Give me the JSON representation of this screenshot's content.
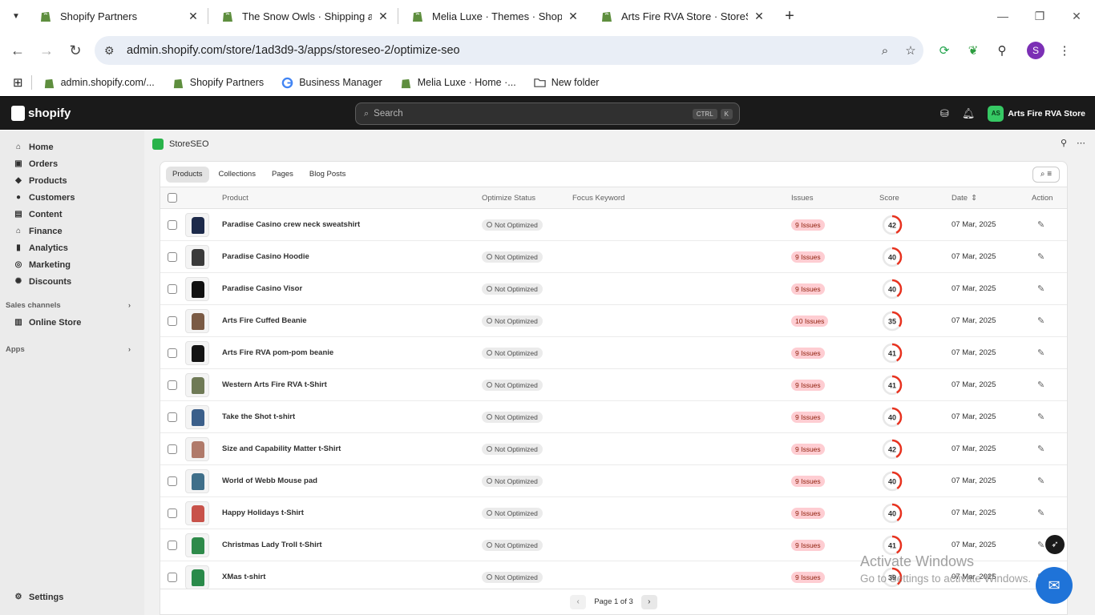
{
  "browser": {
    "tabs": [
      {
        "title": "Shopify Partners",
        "active": false
      },
      {
        "title": "The Snow Owls · Shipping and d",
        "active": false
      },
      {
        "title": "Melia Luxe · Themes · Shopify",
        "active": false
      },
      {
        "title": "Arts Fire RVA Store · StoreSEO ·",
        "active": true
      }
    ],
    "new_tab": "+",
    "url": "admin.shopify.com/store/1ad3d9-3/apps/storeseo-2/optimize-seo",
    "profile_initial": "S",
    "bookmarks": [
      {
        "label": "admin.shopify.com/..."
      },
      {
        "label": "Shopify Partners"
      },
      {
        "label": "Business Manager"
      },
      {
        "label": "Melia Luxe · Home ·..."
      },
      {
        "label": "New folder"
      }
    ]
  },
  "shopify": {
    "logo_text": "shopify",
    "search_placeholder": "Search",
    "search_kbd_1": "CTRL",
    "search_kbd_2": "K",
    "store_initials": "AS",
    "store_name": "Arts Fire RVA Store"
  },
  "sidebar": {
    "items": [
      {
        "label": "Home",
        "icon": "home-icon"
      },
      {
        "label": "Orders",
        "icon": "orders-icon"
      },
      {
        "label": "Products",
        "icon": "tag-icon"
      },
      {
        "label": "Customers",
        "icon": "person-icon"
      },
      {
        "label": "Content",
        "icon": "content-icon"
      },
      {
        "label": "Finance",
        "icon": "bank-icon"
      },
      {
        "label": "Analytics",
        "icon": "bar-chart-icon"
      },
      {
        "label": "Marketing",
        "icon": "target-icon"
      },
      {
        "label": "Discounts",
        "icon": "discount-icon"
      }
    ],
    "sales_channels_label": "Sales channels",
    "online_store_label": "Online Store",
    "apps_label": "Apps",
    "settings_label": "Settings"
  },
  "app": {
    "name": "StoreSEO",
    "tabs": [
      "Products",
      "Collections",
      "Pages",
      "Blog Posts"
    ],
    "active_tab": "Products",
    "columns": {
      "product": "Product",
      "status": "Optimize Status",
      "keyword": "Focus Keyword",
      "issues": "Issues",
      "score": "Score",
      "date": "Date",
      "action": "Action"
    },
    "rows": [
      {
        "name": "Paradise Casino crew neck sweatshirt",
        "status": "Not Optimized",
        "issues": "9 Issues",
        "score": 42,
        "date": "07 Mar, 2025",
        "thumb_color": "#1d2a4a"
      },
      {
        "name": "Paradise Casino Hoodie",
        "status": "Not Optimized",
        "issues": "9 Issues",
        "score": 40,
        "date": "07 Mar, 2025",
        "thumb_color": "#3a3a3a"
      },
      {
        "name": "Paradise Casino Visor",
        "status": "Not Optimized",
        "issues": "9 Issues",
        "score": 40,
        "date": "07 Mar, 2025",
        "thumb_color": "#111111"
      },
      {
        "name": "Arts Fire Cuffed Beanie",
        "status": "Not Optimized",
        "issues": "10 Issues",
        "score": 35,
        "date": "07 Mar, 2025",
        "thumb_color": "#7a5a44"
      },
      {
        "name": "Arts Fire RVA pom-pom beanie",
        "status": "Not Optimized",
        "issues": "9 Issues",
        "score": 41,
        "date": "07 Mar, 2025",
        "thumb_color": "#141414"
      },
      {
        "name": "Western Arts Fire RVA t-Shirt",
        "status": "Not Optimized",
        "issues": "9 Issues",
        "score": 41,
        "date": "07 Mar, 2025",
        "thumb_color": "#6f7a56"
      },
      {
        "name": "Take the Shot t-shirt",
        "status": "Not Optimized",
        "issues": "9 Issues",
        "score": 40,
        "date": "07 Mar, 2025",
        "thumb_color": "#3b5f8a"
      },
      {
        "name": "Size and Capability Matter t-Shirt",
        "status": "Not Optimized",
        "issues": "9 Issues",
        "score": 42,
        "date": "07 Mar, 2025",
        "thumb_color": "#b07a6a"
      },
      {
        "name": "World of Webb Mouse pad",
        "status": "Not Optimized",
        "issues": "9 Issues",
        "score": 40,
        "date": "07 Mar, 2025",
        "thumb_color": "#3f6f8a"
      },
      {
        "name": "Happy Holidays t-Shirt",
        "status": "Not Optimized",
        "issues": "9 Issues",
        "score": 40,
        "date": "07 Mar, 2025",
        "thumb_color": "#c8524a"
      },
      {
        "name": "Christmas Lady Troll t-Shirt",
        "status": "Not Optimized",
        "issues": "9 Issues",
        "score": 41,
        "date": "07 Mar, 2025",
        "thumb_color": "#2e8a4a"
      },
      {
        "name": "XMas t-shirt",
        "status": "Not Optimized",
        "issues": "9 Issues",
        "score": 39,
        "date": "07 Mar, 2025",
        "thumb_color": "#2a8a4a"
      }
    ],
    "pagination": "Page 1 of 3"
  },
  "overlay": {
    "watermark_title": "Activate Windows",
    "watermark_sub": "Go to Settings to activate Windows."
  },
  "colors": {
    "score_ring": "#e8321f",
    "score_track": "#e8e8e8",
    "shopify_bar": "#1a1a1a",
    "shopify_green": "#36c964"
  }
}
